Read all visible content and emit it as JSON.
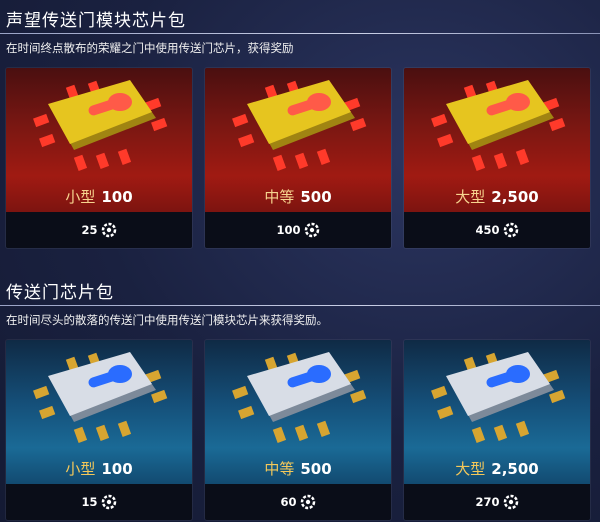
{
  "sections": [
    {
      "title": "声望传送门模块芯片包",
      "description": "在时间终点散布的荣耀之门中使用传送门芯片，获得奖励",
      "theme": "red",
      "items": [
        {
          "size": "小型",
          "amount": "100",
          "cost": "25"
        },
        {
          "size": "中等",
          "amount": "500",
          "cost": "100"
        },
        {
          "size": "大型",
          "amount": "2,500",
          "cost": "450"
        }
      ]
    },
    {
      "title": "传送门芯片包",
      "description": "在时间尽头的散落的传送门中使用传送门模块芯片来获得奖励。",
      "theme": "blue",
      "items": [
        {
          "size": "小型",
          "amount": "100",
          "cost": "15"
        },
        {
          "size": "中等",
          "amount": "500",
          "cost": "60"
        },
        {
          "size": "大型",
          "amount": "2,500",
          "cost": "270"
        }
      ]
    }
  ],
  "colors": {
    "red_chip": "#e6c51f",
    "blue_chip": "#d8dde6",
    "cost_bar": "#0a0d18"
  },
  "icons": {
    "chip_gold": "gold-chip-icon",
    "chip_silver": "silver-chip-icon",
    "currency": "cog-currency-icon"
  }
}
